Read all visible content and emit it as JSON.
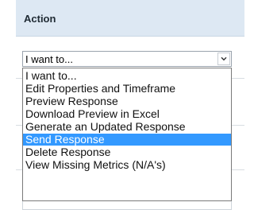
{
  "header": {
    "title": "Action"
  },
  "action_select": {
    "value": "I want to..."
  },
  "dropdown": {
    "options": [
      "I want to...",
      "Edit Properties and Timeframe",
      "Preview Response",
      "Download Preview in Excel",
      "Generate an Updated Response",
      "Send Response",
      "Delete Response",
      "View Missing Metrics (N/A's)"
    ],
    "selected_index": 5
  },
  "colors": {
    "header_bg": "#dde8f3",
    "selection_bg": "#3399ff"
  },
  "icons": {
    "dropdown_button": "chevron-down-icon"
  }
}
